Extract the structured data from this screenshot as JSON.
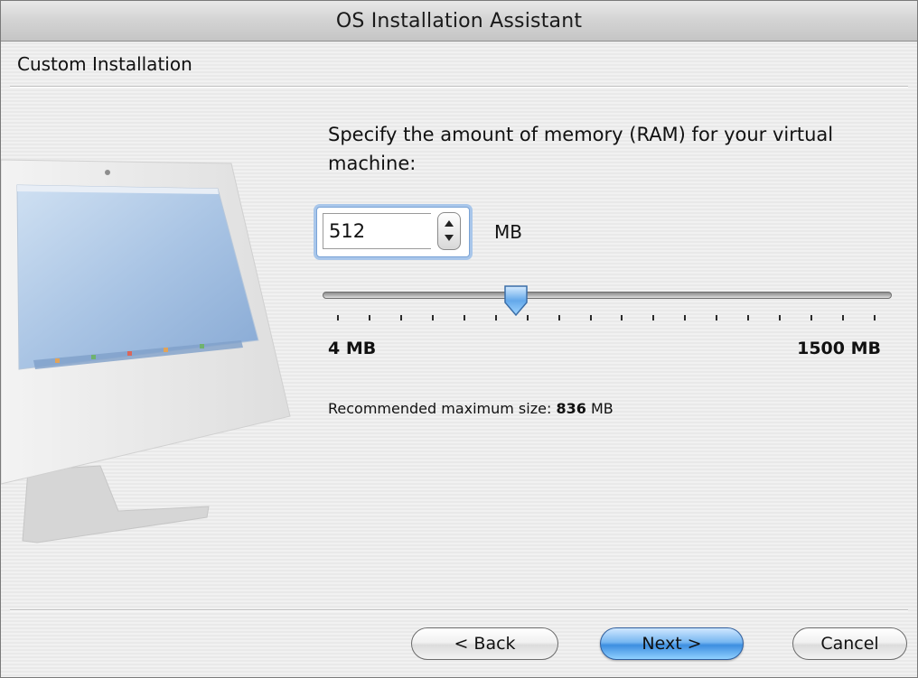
{
  "window": {
    "title": "OS Installation Assistant"
  },
  "section": {
    "header": "Custom Installation"
  },
  "memory": {
    "prompt": "Specify the amount of memory (RAM) for your virtual machine:",
    "value": "512",
    "unit": "MB",
    "slider": {
      "min": 4,
      "max": 1500,
      "value": 512
    },
    "range_min_label": "4 MB",
    "range_max_label": "1500 MB",
    "recommend_prefix": "Recommended maximum size:",
    "recommend_value": "836",
    "recommend_unit": "MB"
  },
  "buttons": {
    "back": "< Back",
    "next": "Next >",
    "cancel": "Cancel"
  },
  "colors": {
    "default_button": "#3d8ee0",
    "focus_ring": "#a8c6ea"
  }
}
